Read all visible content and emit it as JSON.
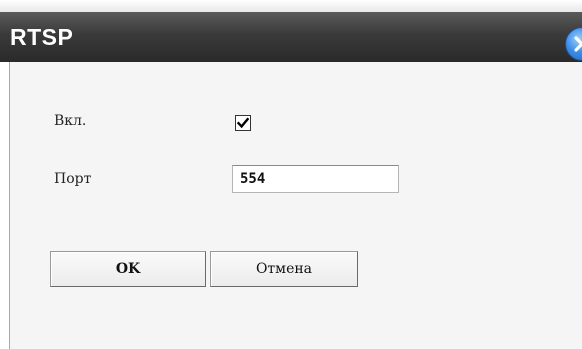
{
  "dialog": {
    "title": "RTSP",
    "close_icon": "close-icon"
  },
  "form": {
    "enable_label": "Вкл.",
    "enable_checked": true,
    "port_label": "Порт",
    "port_value": "554"
  },
  "buttons": {
    "ok_label": "OK",
    "cancel_label": "Отмена"
  },
  "colors": {
    "title_bar": "#3a3a3a",
    "close_button": "#3d8ee6",
    "content_bg": "#f5f5f5"
  }
}
